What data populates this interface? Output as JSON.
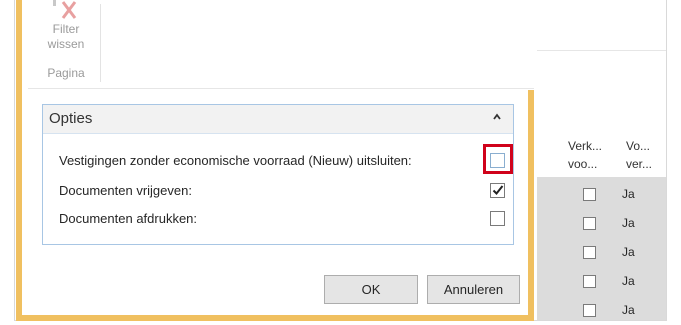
{
  "ribbon": {
    "filter_button": {
      "line1": "Filter",
      "line2": "wissen",
      "icon": "filter-clear-icon"
    },
    "group_label": "Pagina"
  },
  "options_panel": {
    "title": "Opties",
    "collapse_icon": "chevron-up-icon",
    "items": [
      {
        "label": "Vestigingen zonder economische voorraad (Nieuw) uitsluiten:",
        "checked": false,
        "highlighted": true
      },
      {
        "label": "Documenten vrijgeven:",
        "checked": true,
        "highlighted": false
      },
      {
        "label": "Documenten afdrukken:",
        "checked": false,
        "highlighted": false
      }
    ]
  },
  "buttons": {
    "ok": "OK",
    "cancel": "Annuleren"
  },
  "background_grid": {
    "headers": [
      {
        "line1": "Verk...",
        "line2": "voo..."
      },
      {
        "line1": "Vo...",
        "line2": "ver..."
      }
    ],
    "rows": [
      {
        "checked": false,
        "value": "Ja"
      },
      {
        "checked": false,
        "value": "Ja"
      },
      {
        "checked": false,
        "value": "Ja"
      },
      {
        "checked": false,
        "value": "Ja"
      },
      {
        "checked": false,
        "value": "Ja"
      }
    ]
  },
  "colors": {
    "dialog_border": "#f0c060",
    "highlight": "#d0021b",
    "panel_border": "#a8c6e4"
  }
}
